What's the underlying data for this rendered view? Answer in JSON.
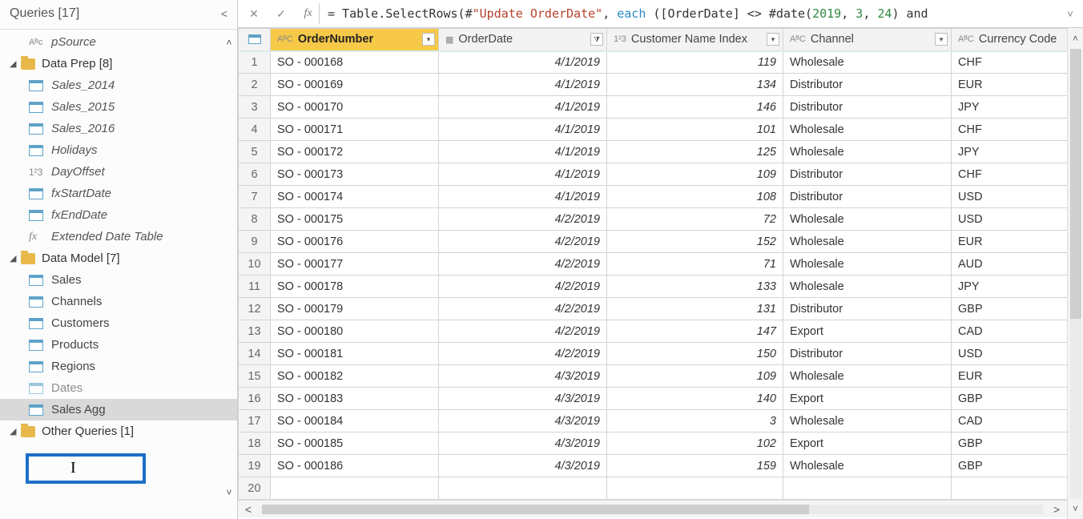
{
  "sidebar": {
    "title": "Queries [17]",
    "psource": "pSource",
    "groups": [
      {
        "label": "Data Prep [8]",
        "expanded": true,
        "items": [
          {
            "icon": "table",
            "label": "Sales_2014",
            "italic": true
          },
          {
            "icon": "table",
            "label": "Sales_2015",
            "italic": true
          },
          {
            "icon": "table",
            "label": "Sales_2016",
            "italic": true
          },
          {
            "icon": "table",
            "label": "Holidays",
            "italic": true
          },
          {
            "icon": "num",
            "label": "DayOffset",
            "italic": true
          },
          {
            "icon": "table",
            "label": "fxStartDate",
            "italic": true
          },
          {
            "icon": "table",
            "label": "fxEndDate",
            "italic": true
          },
          {
            "icon": "fx",
            "label": "Extended Date Table",
            "italic": true
          }
        ]
      },
      {
        "label": "Data Model [7]",
        "expanded": true,
        "items": [
          {
            "icon": "table",
            "label": "Sales"
          },
          {
            "icon": "table",
            "label": "Channels"
          },
          {
            "icon": "table",
            "label": "Customers"
          },
          {
            "icon": "table",
            "label": "Products"
          },
          {
            "icon": "table",
            "label": "Regions"
          },
          {
            "icon": "table",
            "label": "Dates"
          },
          {
            "icon": "table",
            "label": "Sales Agg",
            "selected": true
          }
        ]
      },
      {
        "label": "Other Queries [1]",
        "expanded": true,
        "items": []
      }
    ]
  },
  "formula": {
    "prefix": "= Table.SelectRows(#",
    "str": "\"Update OrderDate\"",
    "mid1": ", ",
    "kw": "each",
    "mid2": " ([OrderDate] <> #date(",
    "n1": "2019",
    "c1": ", ",
    "n2": "3",
    "c2": ", ",
    "n3": "24",
    "tail": ") and"
  },
  "columns": {
    "ordernumber": "OrderNumber",
    "orderdate": "OrderDate",
    "custindex": "Customer Name Index",
    "channel": "Channel",
    "currency": "Currency Code"
  },
  "typeIcons": {
    "abc": "AᴮC",
    "num": "1²3",
    "date": "▦"
  },
  "rows": [
    {
      "n": 1,
      "ord": "SO - 000168",
      "date": "4/1/2019",
      "idx": 119,
      "ch": "Wholesale",
      "cur": "CHF"
    },
    {
      "n": 2,
      "ord": "SO - 000169",
      "date": "4/1/2019",
      "idx": 134,
      "ch": "Distributor",
      "cur": "EUR"
    },
    {
      "n": 3,
      "ord": "SO - 000170",
      "date": "4/1/2019",
      "idx": 146,
      "ch": "Distributor",
      "cur": "JPY"
    },
    {
      "n": 4,
      "ord": "SO - 000171",
      "date": "4/1/2019",
      "idx": 101,
      "ch": "Wholesale",
      "cur": "CHF"
    },
    {
      "n": 5,
      "ord": "SO - 000172",
      "date": "4/1/2019",
      "idx": 125,
      "ch": "Wholesale",
      "cur": "JPY"
    },
    {
      "n": 6,
      "ord": "SO - 000173",
      "date": "4/1/2019",
      "idx": 109,
      "ch": "Distributor",
      "cur": "CHF"
    },
    {
      "n": 7,
      "ord": "SO - 000174",
      "date": "4/1/2019",
      "idx": 108,
      "ch": "Distributor",
      "cur": "USD"
    },
    {
      "n": 8,
      "ord": "SO - 000175",
      "date": "4/2/2019",
      "idx": 72,
      "ch": "Wholesale",
      "cur": "USD"
    },
    {
      "n": 9,
      "ord": "SO - 000176",
      "date": "4/2/2019",
      "idx": 152,
      "ch": "Wholesale",
      "cur": "EUR"
    },
    {
      "n": 10,
      "ord": "SO - 000177",
      "date": "4/2/2019",
      "idx": 71,
      "ch": "Wholesale",
      "cur": "AUD"
    },
    {
      "n": 11,
      "ord": "SO - 000178",
      "date": "4/2/2019",
      "idx": 133,
      "ch": "Wholesale",
      "cur": "JPY"
    },
    {
      "n": 12,
      "ord": "SO - 000179",
      "date": "4/2/2019",
      "idx": 131,
      "ch": "Distributor",
      "cur": "GBP"
    },
    {
      "n": 13,
      "ord": "SO - 000180",
      "date": "4/2/2019",
      "idx": 147,
      "ch": "Export",
      "cur": "CAD"
    },
    {
      "n": 14,
      "ord": "SO - 000181",
      "date": "4/2/2019",
      "idx": 150,
      "ch": "Distributor",
      "cur": "USD"
    },
    {
      "n": 15,
      "ord": "SO - 000182",
      "date": "4/3/2019",
      "idx": 109,
      "ch": "Wholesale",
      "cur": "EUR"
    },
    {
      "n": 16,
      "ord": "SO - 000183",
      "date": "4/3/2019",
      "idx": 140,
      "ch": "Export",
      "cur": "GBP"
    },
    {
      "n": 17,
      "ord": "SO - 000184",
      "date": "4/3/2019",
      "idx": 3,
      "ch": "Wholesale",
      "cur": "CAD"
    },
    {
      "n": 18,
      "ord": "SO - 000185",
      "date": "4/3/2019",
      "idx": 102,
      "ch": "Export",
      "cur": "GBP"
    },
    {
      "n": 19,
      "ord": "SO - 000186",
      "date": "4/3/2019",
      "idx": 159,
      "ch": "Wholesale",
      "cur": "GBP"
    },
    {
      "n": 20,
      "ord": "",
      "date": "",
      "idx": "",
      "ch": "",
      "cur": ""
    }
  ]
}
